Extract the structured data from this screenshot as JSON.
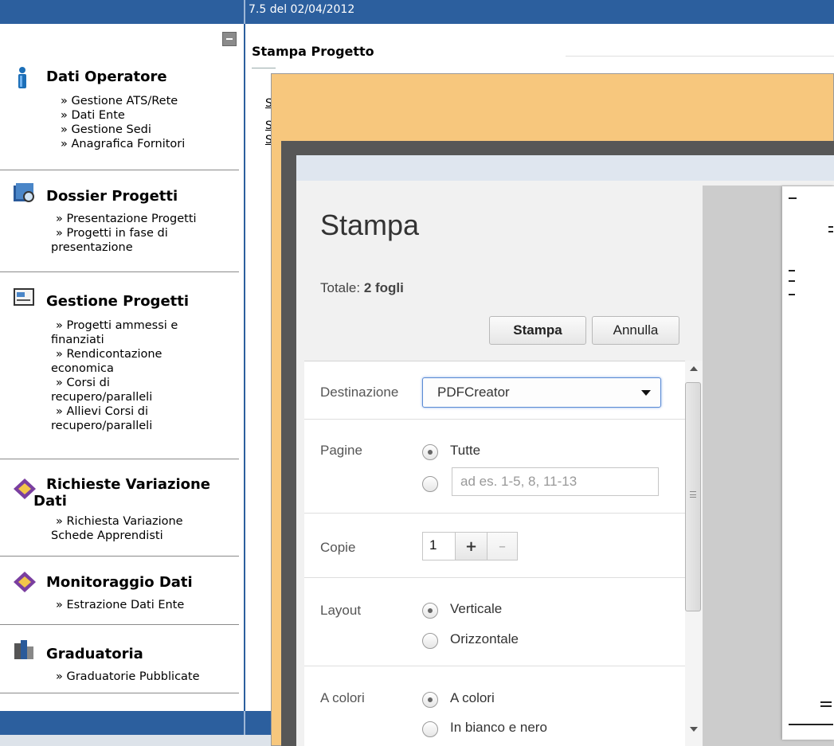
{
  "topbar": {
    "version_text": "7.5 del 02/04/2012"
  },
  "sidebar": {
    "sections": [
      {
        "title": "Dati Operatore",
        "links": [
          "» Gestione ATS/Rete",
          "» Dati Ente",
          "» Gestione Sedi",
          "» Anagrafica Fornitori"
        ]
      },
      {
        "title": "Dossier Progetti",
        "links": [
          "» Presentazione Progetti",
          "» Progetti in fase di",
          "presentazione"
        ]
      },
      {
        "title": "Gestione Progetti",
        "links": [
          "» Progetti ammessi e",
          "finanziati",
          "» Rendicontazione",
          "economica",
          "» Corsi di",
          "recupero/paralleli",
          "» Allievi Corsi di",
          "recupero/paralleli"
        ]
      },
      {
        "title": "Richieste Variazione",
        "title2": "Dati",
        "links": [
          "» Richiesta Variazione",
          "Schede Apprendisti"
        ]
      },
      {
        "title": "Monitoraggio Dati",
        "links": [
          "» Estrazione Dati Ente"
        ]
      },
      {
        "title": "Graduatoria",
        "links": [
          "» Graduatorie Pubblicate"
        ]
      }
    ]
  },
  "main": {
    "page_title": "Stampa Progetto",
    "bg_links": [
      "S",
      "S",
      "S"
    ]
  },
  "print_dialog": {
    "title": "Stampa",
    "totale_label": "Totale:",
    "totale_value": "2 fogli",
    "print_button": "Stampa",
    "cancel_button": "Annulla",
    "destination_label": "Destinazione",
    "destination_value": "PDFCreator",
    "pages_label": "Pagine",
    "pages_all": "Tutte",
    "pages_placeholder": "ad es. 1-5, 8, 11-13",
    "copies_label": "Copie",
    "copies_value": "1",
    "copies_plus": "+",
    "copies_minus": "–",
    "layout_label": "Layout",
    "layout_portrait": "Verticale",
    "layout_landscape": "Orizzontale",
    "color_label": "A colori",
    "color_color": "A colori",
    "color_bw": "In bianco e nero"
  },
  "colors": {
    "brand_blue": "#2c5f9e",
    "dialog_orange": "#f7c77d"
  }
}
